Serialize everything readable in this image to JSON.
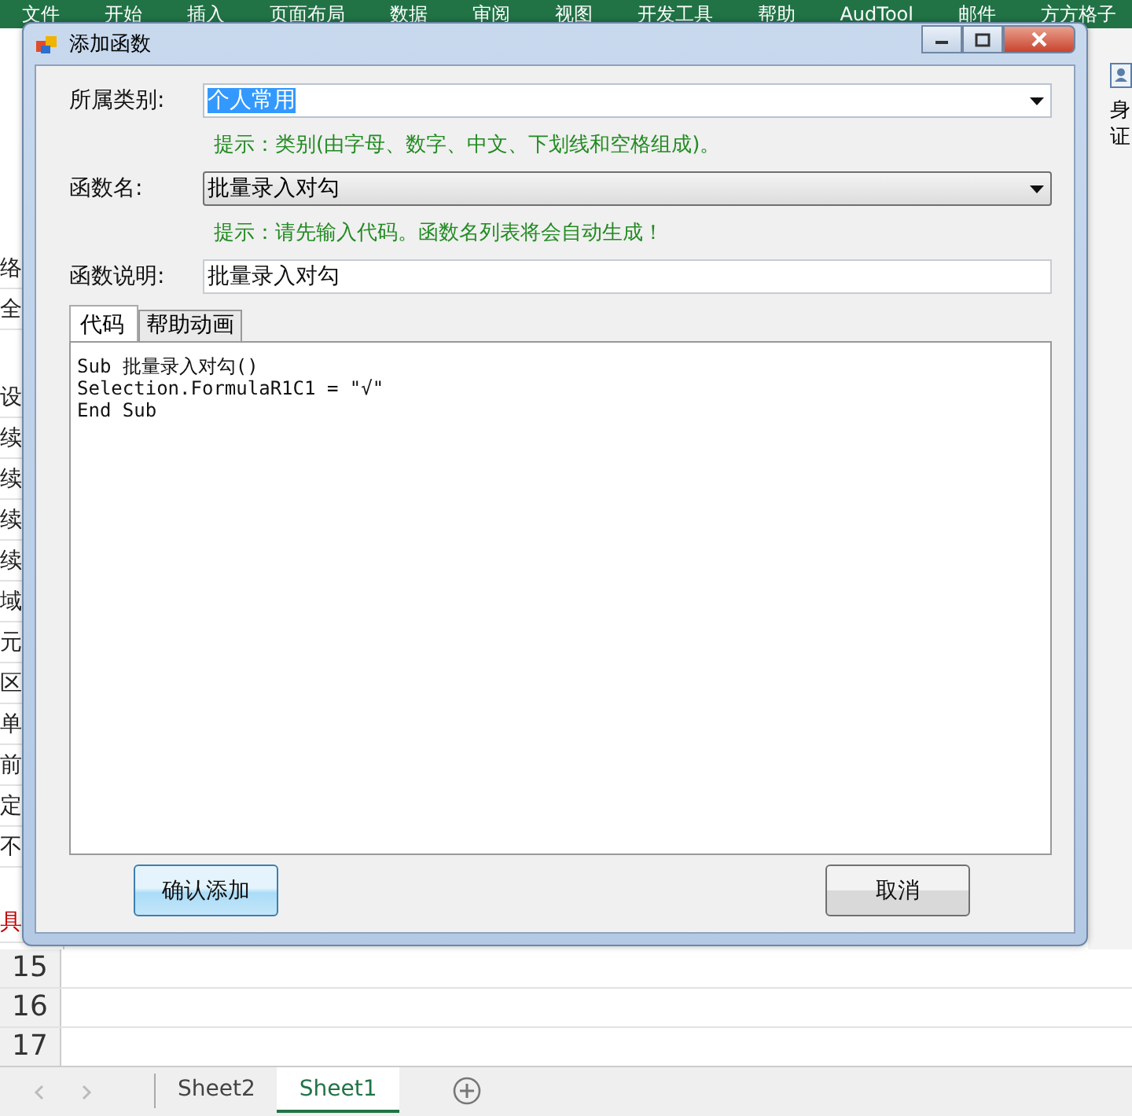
{
  "ribbon": {
    "tabs": [
      "文件",
      "开始",
      "插入",
      "页面布局",
      "数据",
      "审阅",
      "视图",
      "开发工具",
      "帮助",
      "AudTool",
      "邮件",
      "方方格子"
    ]
  },
  "sheet_left_cells": [
    {
      "text": "络",
      "kind": "normal"
    },
    {
      "text": "全",
      "kind": "normal"
    },
    {
      "text": "设",
      "kind": "normal"
    },
    {
      "text": "续",
      "kind": "normal"
    },
    {
      "text": "续",
      "kind": "normal"
    },
    {
      "text": "续",
      "kind": "normal"
    },
    {
      "text": "续",
      "kind": "normal"
    },
    {
      "text": "域",
      "kind": "normal"
    },
    {
      "text": "元",
      "kind": "normal"
    },
    {
      "text": "区",
      "kind": "normal"
    },
    {
      "text": "单",
      "kind": "normal"
    },
    {
      "text": "前",
      "kind": "normal"
    },
    {
      "text": "定",
      "kind": "normal"
    },
    {
      "text": "不",
      "kind": "normal"
    },
    {
      "text": "具",
      "kind": "warning"
    }
  ],
  "sheet_right_cells": [
    "身",
    "证"
  ],
  "row_headers": [
    "15",
    "16",
    "17"
  ],
  "sheet_tabs": [
    {
      "label": "Sheet2",
      "selected": false
    },
    {
      "label": "Sheet1",
      "selected": true
    }
  ],
  "dialog": {
    "title": "添加函数",
    "category": {
      "label": "所属类别:",
      "value": "个人常用",
      "text_selected": true,
      "hint": "提示：类别(由字母、数字、中文、下划线和空格组成)。"
    },
    "function_name": {
      "label": "函数名:",
      "value": "批量录入对勾",
      "hint": "提示：请先输入代码。函数名列表将会自动生成！"
    },
    "description": {
      "label": "函数说明:",
      "value": "批量录入对勾"
    },
    "tabs": [
      {
        "label": "代码",
        "selected": true
      },
      {
        "label": "帮助动画",
        "selected": false
      }
    ],
    "code": [
      "Sub 批量录入对勾()",
      "Selection.FormulaR1C1 = \"√\"",
      "End Sub"
    ],
    "buttons": [
      {
        "label": "确认添加",
        "highlighted": true
      },
      {
        "label": "取消",
        "highlighted": false
      }
    ]
  }
}
